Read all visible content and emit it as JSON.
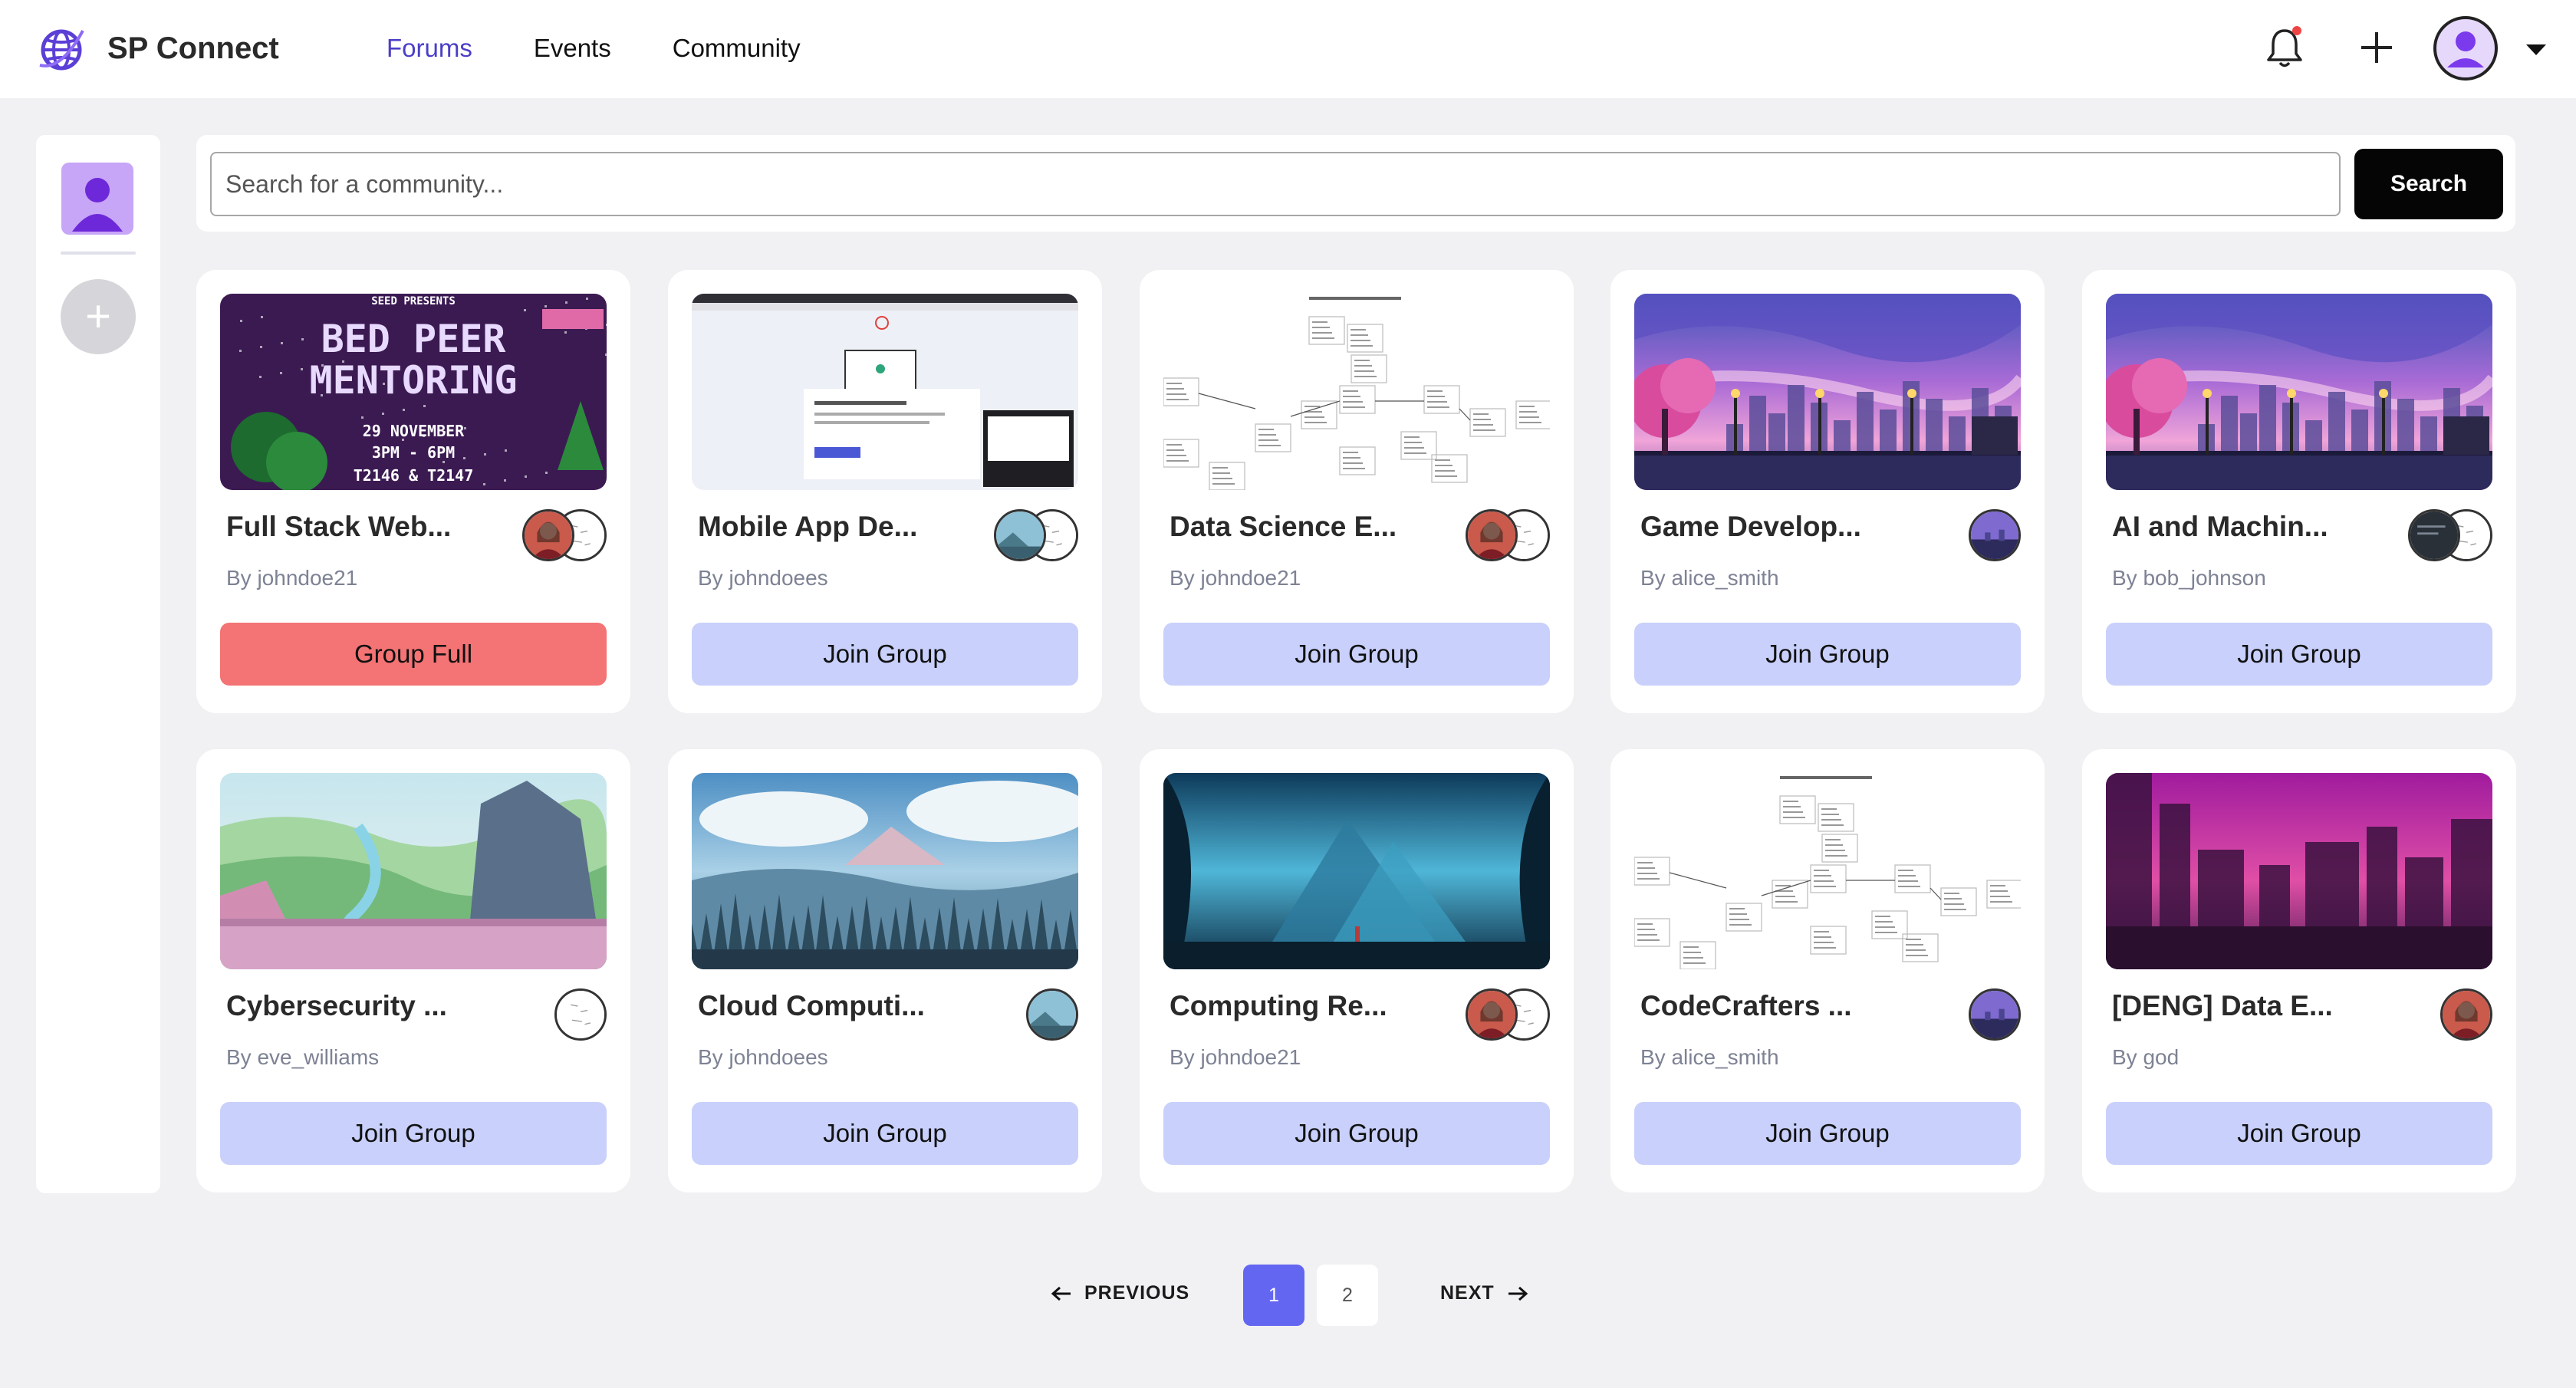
{
  "app": {
    "name": "SP Connect"
  },
  "nav": {
    "links": [
      {
        "label": "Forums",
        "active": true
      },
      {
        "label": "Events",
        "active": false
      },
      {
        "label": "Community",
        "active": false
      }
    ]
  },
  "search": {
    "placeholder": "Search for a community...",
    "button_label": "Search"
  },
  "cards": [
    {
      "title": "Full Stack Web...",
      "author": "By johndoe21",
      "button": "Group Full",
      "full": true,
      "thumb": "poster",
      "poster_lines": [
        "SEED PRESENTS",
        "BED PEER",
        "MENTORING",
        "29 NOVEMBER",
        "3PM - 6PM",
        "T2146 & T2147"
      ]
    },
    {
      "title": "Mobile App De...",
      "author": "By johndoees",
      "button": "Join Group",
      "full": false,
      "thumb": "screenshot"
    },
    {
      "title": "Data Science E...",
      "author": "By johndoe21",
      "button": "Join Group",
      "full": false,
      "thumb": "diagram"
    },
    {
      "title": "Game Develop...",
      "author": "By alice_smith",
      "button": "Join Group",
      "full": false,
      "thumb": "city-pink"
    },
    {
      "title": "AI and Machin...",
      "author": "By bob_johnson",
      "button": "Join Group",
      "full": false,
      "thumb": "city-pink"
    },
    {
      "title": "Cybersecurity ...",
      "author": "By eve_williams",
      "button": "Join Group",
      "full": false,
      "thumb": "valley"
    },
    {
      "title": "Cloud Computi...",
      "author": "By johndoees",
      "button": "Join Group",
      "full": false,
      "thumb": "forest"
    },
    {
      "title": "Computing Re...",
      "author": "By johndoe21",
      "button": "Join Group",
      "full": false,
      "thumb": "blue-fantasy"
    },
    {
      "title": "CodeCrafters ...",
      "author": "By alice_smith",
      "button": "Join Group",
      "full": false,
      "thumb": "diagram"
    },
    {
      "title": "[DENG] Data E...",
      "author": "By god",
      "button": "Join Group",
      "full": false,
      "thumb": "magenta-city"
    }
  ],
  "pagination": {
    "prev_label": "PREVIOUS",
    "next_label": "NEXT",
    "pages": [
      "1",
      "2"
    ],
    "current": "1"
  },
  "colors": {
    "accent": "#6366f1",
    "join": "#c8d0fb",
    "full": "#f47374",
    "nav_active": "#4b3fc7"
  }
}
